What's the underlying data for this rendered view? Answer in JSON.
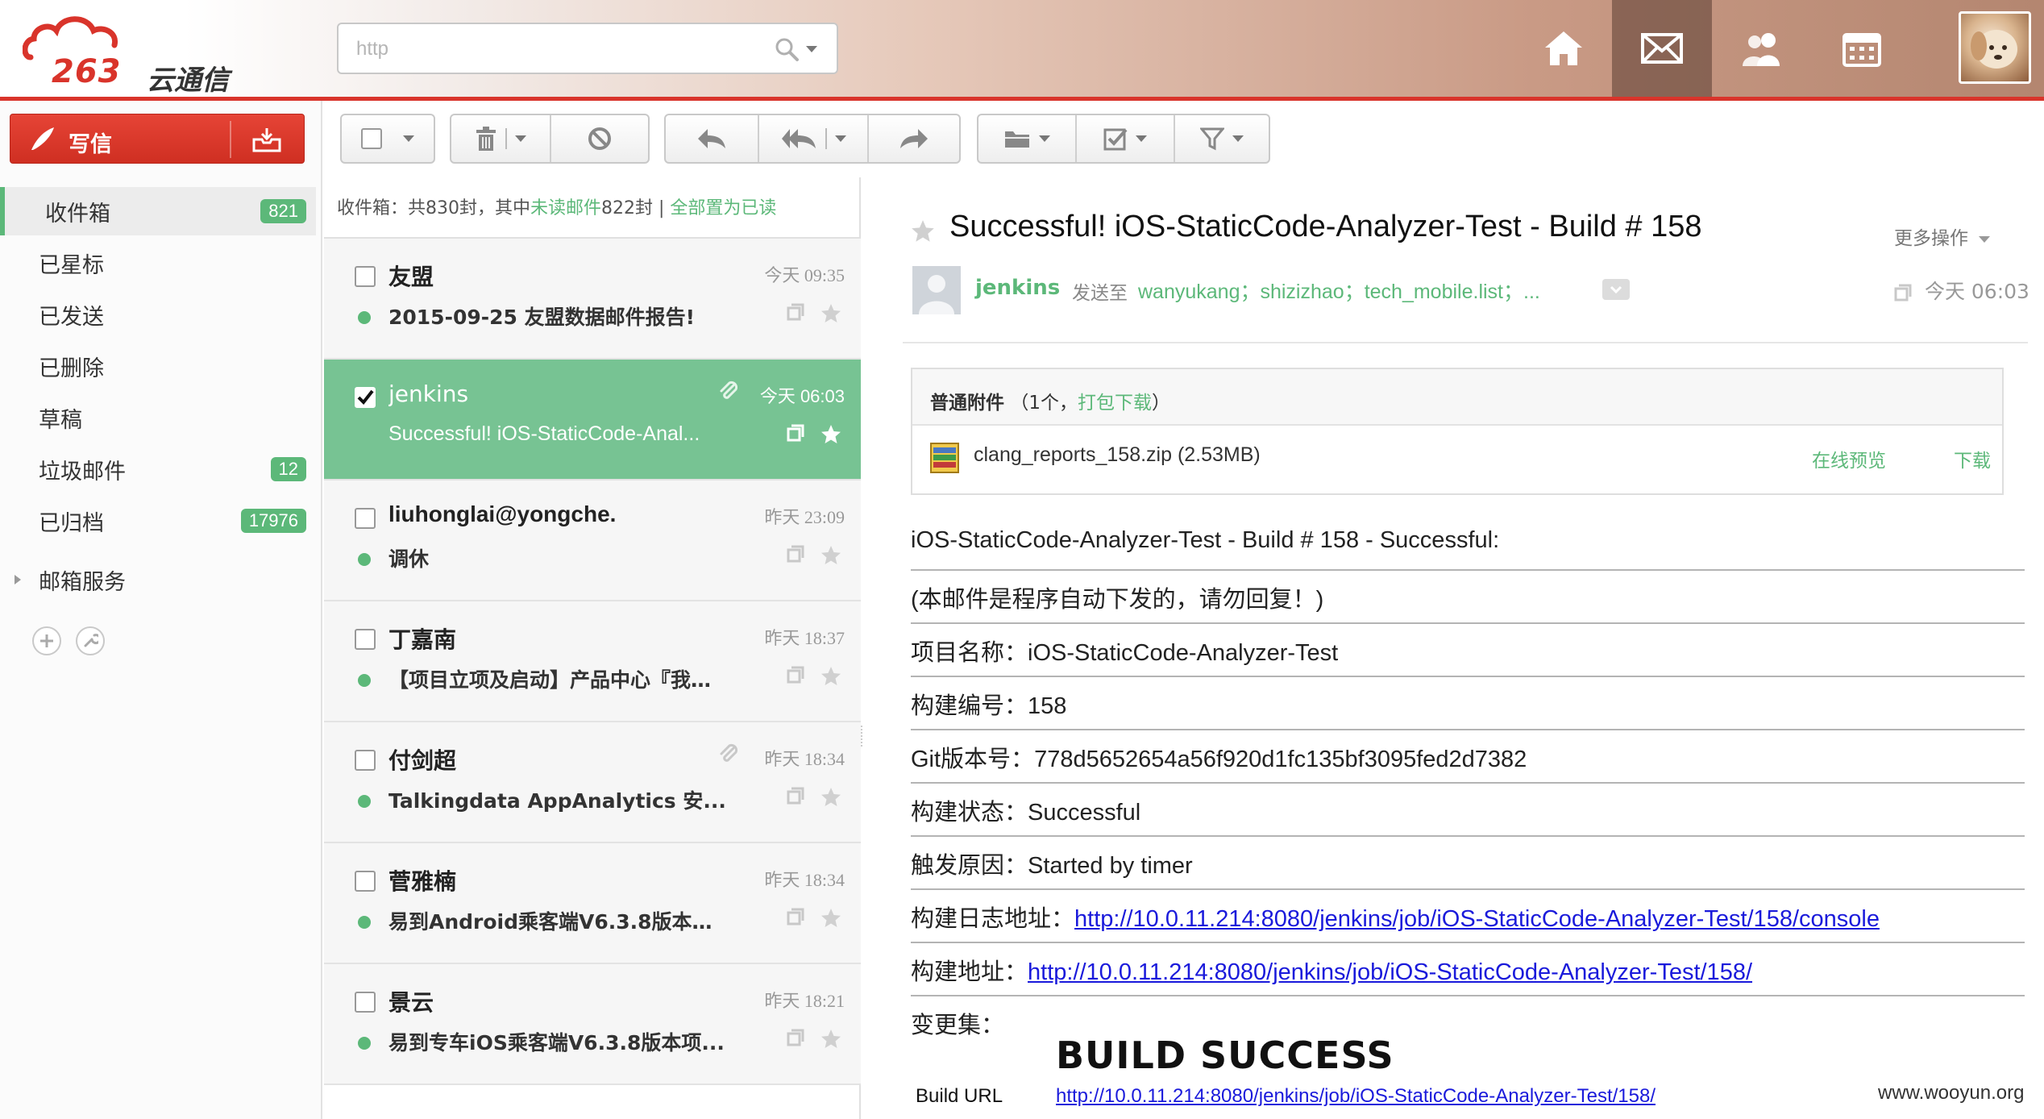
{
  "header": {
    "logo_text": "263",
    "logo_sub": "云通信",
    "search_placeholder": "http",
    "nav": [
      "home-icon",
      "mail-icon",
      "contacts-icon",
      "calendar-icon"
    ]
  },
  "sidebar": {
    "compose_label": "写信",
    "folders": [
      {
        "label": "收件箱",
        "count": "821"
      },
      {
        "label": "已星标",
        "count": ""
      },
      {
        "label": "已发送",
        "count": ""
      },
      {
        "label": "已删除",
        "count": ""
      },
      {
        "label": "草稿",
        "count": ""
      },
      {
        "label": "垃圾邮件",
        "count": "12"
      },
      {
        "label": "已归档",
        "count": "17976"
      },
      {
        "label": "邮箱服务",
        "count": ""
      }
    ]
  },
  "list": {
    "summary_prefix": "收件箱：共830封，其中",
    "summary_unread_link": "未读邮件",
    "summary_suffix": "822封 |",
    "summary_mark_all": "全部置为已读",
    "messages": [
      {
        "sender": "友盟",
        "time": "今天 09:35",
        "subject": "2015-09-25 友盟数据邮件报告!",
        "attachment": false
      },
      {
        "sender": "jenkins",
        "time": "今天 06:03",
        "subject": "Successful! iOS-StaticCode-Anal...",
        "attachment": true
      },
      {
        "sender": "liuhonglai@yongche.",
        "time": "昨天 23:09",
        "subject": "调休",
        "attachment": false
      },
      {
        "sender": "丁嘉南",
        "time": "昨天 18:37",
        "subject": "【项目立项及启动】产品中心『我给...",
        "attachment": false
      },
      {
        "sender": "付剑超",
        "time": "昨天 18:34",
        "subject": "Talkingdata AppAnalytics 安...",
        "attachment": true
      },
      {
        "sender": "菅雅楠",
        "time": "昨天 18:34",
        "subject": "易到Android乘客端V6.3.8版本项...",
        "attachment": false
      },
      {
        "sender": "景云",
        "time": "昨天 18:21",
        "subject": "易到专车iOS乘客端V6.3.8版本项...",
        "attachment": false
      }
    ]
  },
  "reader": {
    "title": "Successful! iOS-StaticCode-Analyzer-Test - Build # 158",
    "more_ops": "更多操作",
    "from": "jenkins",
    "sent_to_label": "发送至",
    "recipients": "wanyukang；shizizhao；tech_mobile.list；...",
    "time": "今天 06:03",
    "attachment": {
      "label": "普通附件",
      "count_text": "（1个，",
      "pack_download": "打包下载",
      "close_paren": "）",
      "filename": "clang_reports_158.zip (2.53MB)",
      "preview": "在线预览",
      "download": "下载"
    },
    "body": {
      "line1": "iOS-StaticCode-Analyzer-Test - Build # 158 - Successful:",
      "line2": "(本邮件是程序自动下发的，请勿回复！)",
      "project_label": "项目名称：",
      "project_value": "iOS-StaticCode-Analyzer-Test",
      "build_no_label": "构建编号：",
      "build_no_value": "158",
      "git_label": "Git版本号：",
      "git_value": "778d5652654a56f920d1fc135bf3095fed2d7382",
      "status_label": "构建状态：",
      "status_value": "Successful",
      "trigger_label": "触发原因：",
      "trigger_value": "Started by timer",
      "log_label": "构建日志地址：",
      "log_url": "http://10.0.11.214:8080/jenkins/job/iOS-StaticCode-Analyzer-Test/158/console",
      "build_addr_label": "构建地址：",
      "build_addr_url": "http://10.0.11.214:8080/jenkins/job/iOS-StaticCode-Analyzer-Test/158/",
      "changeset_label": "变更集：",
      "build_success": "BUILD SUCCESS",
      "build_url_label": "Build URL",
      "build_url_value": "http://10.0.11.214:8080/jenkins/job/iOS-StaticCode-Analyzer-Test/158/"
    }
  },
  "watermark": "www.wooyun.org",
  "colors": {
    "brand_red": "#d9342b",
    "accent_green": "#5cb879",
    "selected_row": "#77c393",
    "link_blue": "#1a1adb"
  }
}
